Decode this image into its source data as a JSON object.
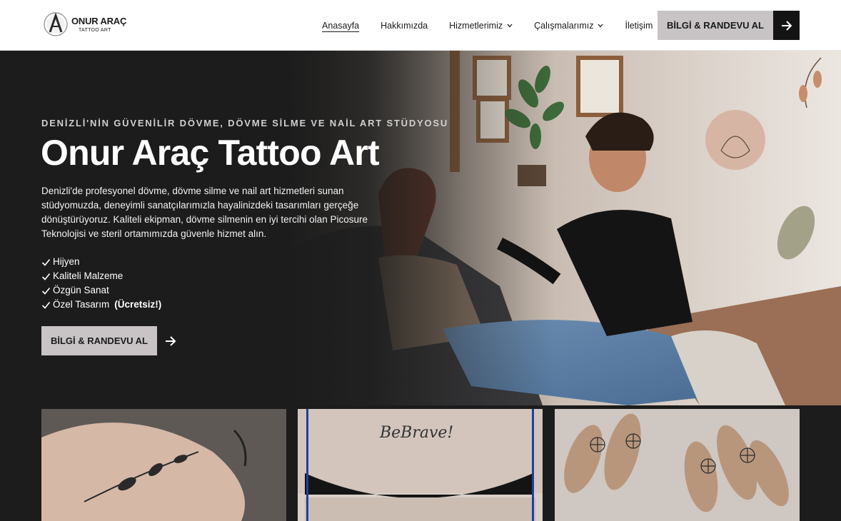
{
  "brand": {
    "name": "ONUR ARAÇ",
    "subtitle": "TATTOO ART",
    "logo_icon": "ao-monogram-logo"
  },
  "nav": {
    "items": [
      {
        "label": "Anasayfa",
        "active": true,
        "dropdown": false
      },
      {
        "label": "Hakkımızda",
        "active": false,
        "dropdown": false
      },
      {
        "label": "Hizmetlerimiz",
        "active": false,
        "dropdown": true
      },
      {
        "label": "Çalışmalarımız",
        "active": false,
        "dropdown": true
      },
      {
        "label": "İletişim",
        "active": false,
        "dropdown": false
      }
    ],
    "dropdown_icon": "chevron-down-icon"
  },
  "header_cta": {
    "label": "BİLGİ & RANDEVU AL",
    "icon": "arrow-right-icon"
  },
  "hero": {
    "kicker": "DENİZLİ'NİN GÜVENİLİR DÖVME, DÖVME SİLME VE NAİL ART STÜDYOSU",
    "title": "Onur Araç Tattoo Art",
    "description": "Denizli'de profesyonel dövme, dövme silme ve nail art hizmetleri sunan stüdyomuzda, deneyimli sanatçılarımızla hayalinizdeki tasarımları gerçeğe dönüştürüyoruz. Kaliteli ekipman, dövme silmenin en iyi tercihi olan Picosure Teknolojisi ve steril ortamımızda güvenle hizmet alın.",
    "features": [
      {
        "text": "Hijyen",
        "bold": ""
      },
      {
        "text": "Kaliteli Malzeme",
        "bold": ""
      },
      {
        "text": "Özgün Sanat",
        "bold": ""
      },
      {
        "text": "Özel Tasarım",
        "bold": "(Ücretsiz!)"
      }
    ],
    "cta_label": "BİLGİ & RANDEVU AL",
    "cta_icon": "arrow-right-icon",
    "check_icon": "check-icon",
    "photo": "tattoo-artist-working-photo"
  },
  "gallery": {
    "items": [
      {
        "name": "floral-shoulder-tattoo-photo",
        "caption": ""
      },
      {
        "name": "script-tattoo-photo",
        "caption": "BeBrave!"
      },
      {
        "name": "spiderweb-nail-art-photo",
        "caption": ""
      }
    ]
  },
  "colors": {
    "header_bg": "#ffffff",
    "hero_bg": "#1c1c1c",
    "cta_bg": "#c8c4c6",
    "cta_arrow_bg": "#141414",
    "text_dark": "#1b1b1b"
  }
}
